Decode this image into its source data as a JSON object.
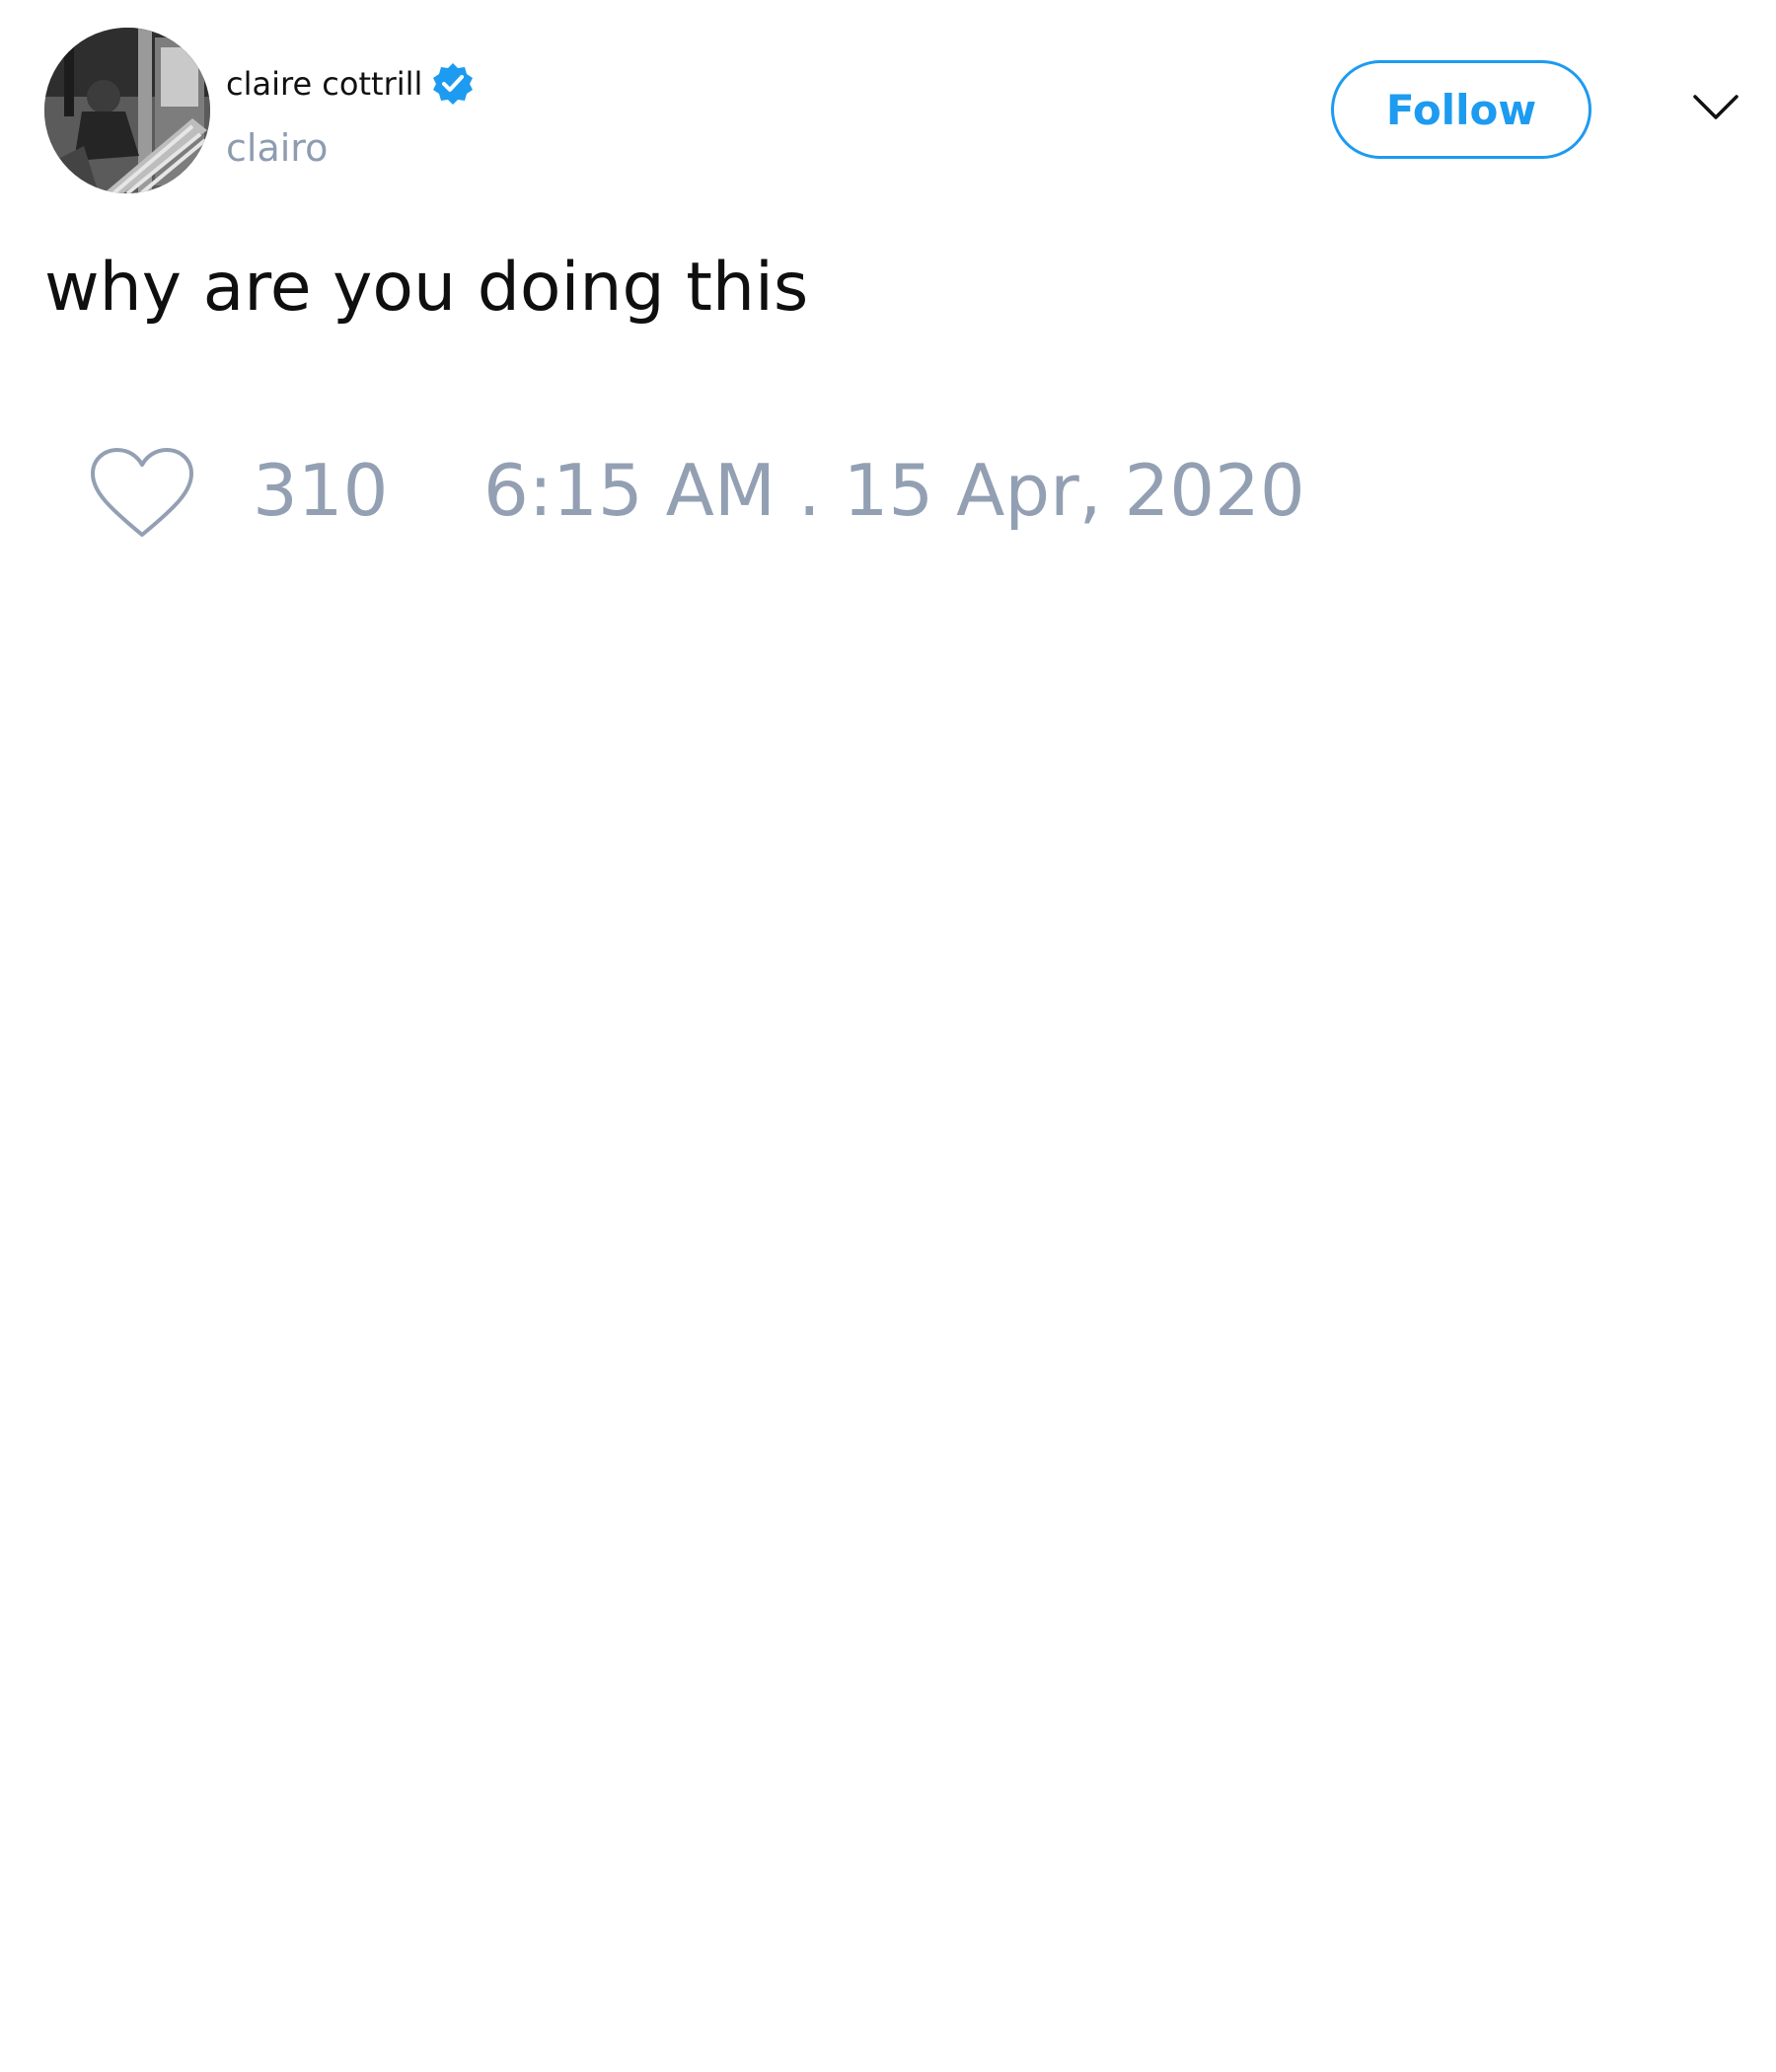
{
  "author": {
    "display_name": "claire cottrill",
    "handle": "clairo",
    "verified_icon": "verified-badge-icon",
    "avatar_icon": "profile-photo"
  },
  "actions": {
    "follow_label": "Follow",
    "menu_icon": "chevron-down-icon"
  },
  "tweet": {
    "text": "why are you doing this",
    "like_icon": "heart-icon",
    "like_count": "310",
    "timestamp": "6:15 AM . 15 Apr, 2020"
  },
  "colors": {
    "accent": "#1d9bf0",
    "muted_text": "#93a0b3",
    "primary_text": "#0f0f0f"
  }
}
